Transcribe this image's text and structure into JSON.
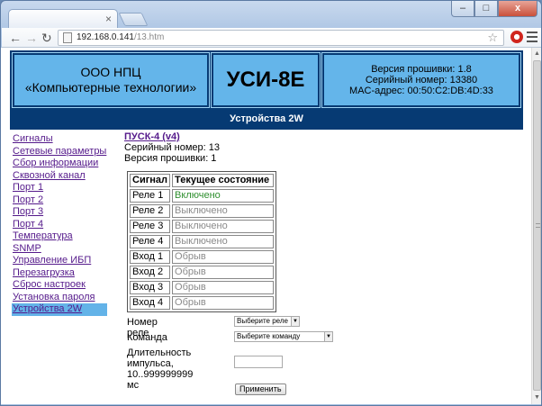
{
  "browser": {
    "url_host": "192.168.0.141",
    "url_path": "/13.htm",
    "window_buttons": {
      "minimize": "–",
      "maximize": "□",
      "close": "x"
    },
    "tab_close": "×"
  },
  "header": {
    "company_line1": "ООО НПЦ",
    "company_line2": "«Компьютерные технологии»",
    "device": "УСИ-8Е",
    "firmware": "Версия прошивки: 1.8",
    "serial": "Серийный номер: 13380",
    "mac": "MAC-адрес: 00:50:C2:DB:4D:33",
    "subtitle": "Устройства 2W"
  },
  "sidebar": {
    "items": [
      "Сигналы",
      "Сетевые параметры",
      "Сбор информации",
      "Сквозной канал",
      "Порт 1",
      "Порт 2",
      "Порт 3",
      "Порт 4",
      "Температура",
      "SNMP",
      "Управление ИБП",
      "Перезагрузка",
      "Сброс настроек",
      "Установка пароля",
      "Устройства 2W"
    ],
    "active_index": 14
  },
  "device": {
    "title": "ПУСК-4 (v4)",
    "serial": "Серийный номер: 13",
    "firmware": "Версия прошивки: 1"
  },
  "signals": {
    "header_signal": "Сигнал",
    "header_state": "Текущее состояние",
    "rows": [
      {
        "signal": "Реле 1",
        "state": "Включено",
        "on": true
      },
      {
        "signal": "Реле 2",
        "state": "Выключено",
        "on": false
      },
      {
        "signal": "Реле 3",
        "state": "Выключено",
        "on": false
      },
      {
        "signal": "Реле 4",
        "state": "Выключено",
        "on": false
      },
      {
        "signal": "Вход 1",
        "state": "Обрыв",
        "on": false
      },
      {
        "signal": "Вход 2",
        "state": "Обрыв",
        "on": false
      },
      {
        "signal": "Вход 3",
        "state": "Обрыв",
        "on": false
      },
      {
        "signal": "Вход 4",
        "state": "Обрыв",
        "on": false
      }
    ]
  },
  "form": {
    "relay_label": "Номер реле",
    "relay_select": "Выберите реле",
    "command_label": "Команда",
    "command_select": "Выберите команду",
    "duration_line1": "Длительность",
    "duration_line2": "импульса,",
    "duration_line3": "10..999999999 мс",
    "duration_value": "",
    "apply_button": "Применить"
  }
}
